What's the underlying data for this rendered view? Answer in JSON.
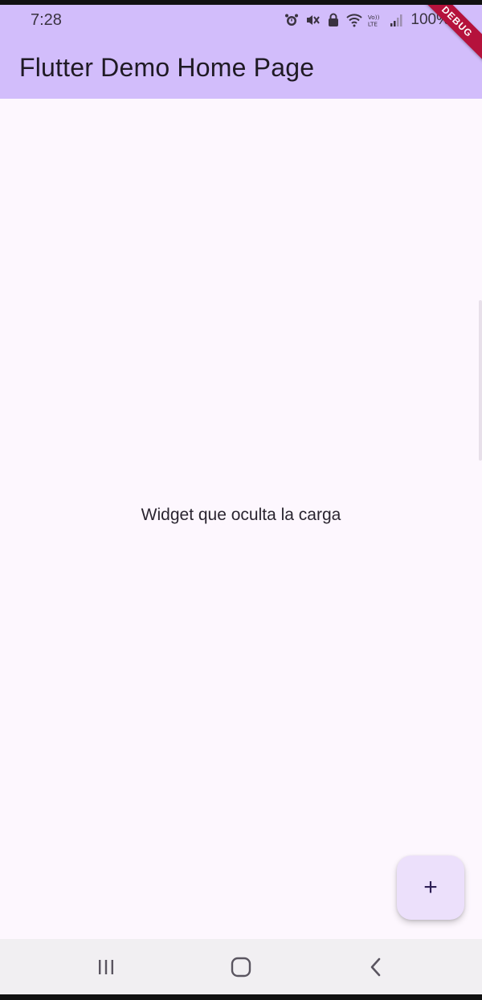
{
  "status_bar": {
    "time": "7:28",
    "battery": "100%",
    "icons": [
      "alarm-icon",
      "mute-icon",
      "lock-icon",
      "wifi-icon",
      "volte-icon",
      "signal-icon",
      "battery-icon"
    ]
  },
  "appbar": {
    "title": "Flutter Demo Home Page",
    "color": "#d2bdfb"
  },
  "debug_banner": {
    "label": "DEBUG"
  },
  "body": {
    "message": "Widget que oculta la carga"
  },
  "fab": {
    "icon": "+",
    "icon_name": "add-icon"
  },
  "navbar": {
    "buttons": [
      "recents-icon",
      "home-icon",
      "back-icon"
    ]
  },
  "colors": {
    "background": "#fdf7fe",
    "fab": "#ece0fb",
    "debug": "#b5123c"
  }
}
